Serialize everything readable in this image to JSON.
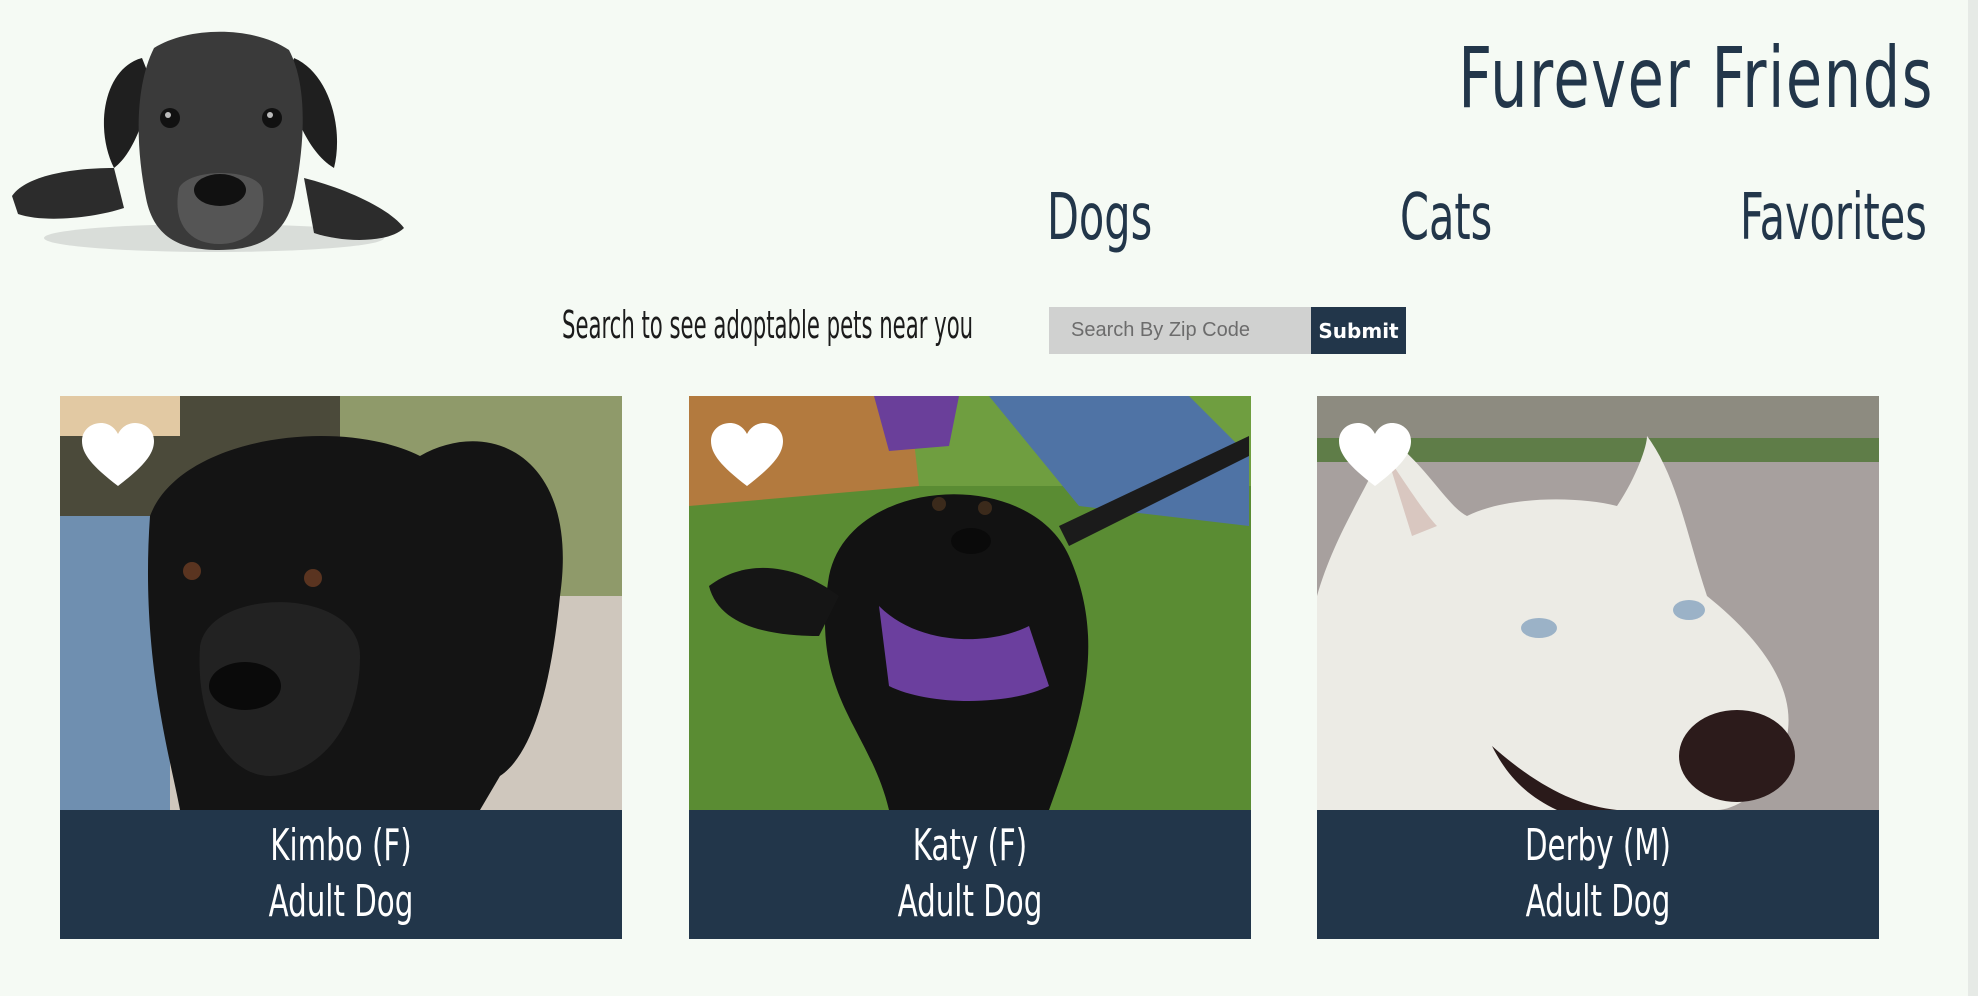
{
  "site": {
    "title": "Furever Friends"
  },
  "nav": {
    "dogs_label": "Dogs",
    "cats_label": "Cats",
    "favorites_label": "Favorites"
  },
  "search": {
    "label": "Search to see adoptable pets near you",
    "placeholder": "Search By Zip Code",
    "value": "",
    "submit_label": "Submit"
  },
  "colors": {
    "navy": "#22364a",
    "background": "#f5faf4",
    "input_bg": "#d0d1d0"
  },
  "pets": [
    {
      "name": "Kimbo (F)",
      "kind": "Adult Dog",
      "favorite_icon": "heart-icon"
    },
    {
      "name": "Katy (F)",
      "kind": "Adult Dog",
      "favorite_icon": "heart-icon"
    },
    {
      "name": "Derby (M)",
      "kind": "Adult Dog",
      "favorite_icon": "heart-icon"
    }
  ]
}
